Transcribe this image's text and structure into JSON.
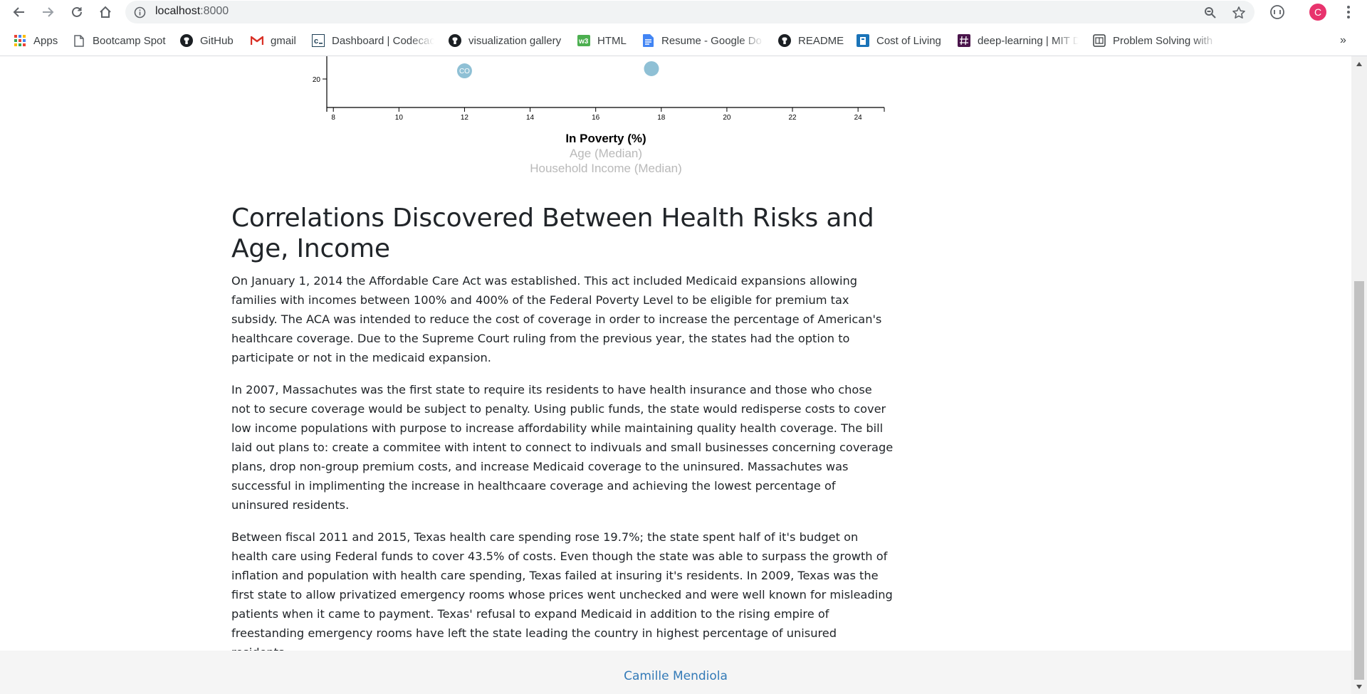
{
  "browser": {
    "url_host": "localhost",
    "url_port": ":8000",
    "profile_initial": "C",
    "accent_profile": "#e8336d"
  },
  "bookmarks": [
    {
      "label": "Apps",
      "icon": "apps-grid-icon"
    },
    {
      "label": "Bootcamp Spot",
      "icon": "page-icon"
    },
    {
      "label": "GitHub",
      "icon": "github-icon"
    },
    {
      "label": "gmail",
      "icon": "gmail-icon"
    },
    {
      "label": "Dashboard | Codecac",
      "icon": "codecademy-icon"
    },
    {
      "label": "visualization gallery",
      "icon": "github-icon"
    },
    {
      "label": "HTML",
      "icon": "w3schools-icon"
    },
    {
      "label": "Resume - Google Do",
      "icon": "google-docs-icon"
    },
    {
      "label": "README",
      "icon": "github-icon"
    },
    {
      "label": "Cost of Living",
      "icon": "cost-of-living-icon"
    },
    {
      "label": "deep-learning | MIT D",
      "icon": "slack-icon"
    },
    {
      "label": "Problem Solving with",
      "icon": "book-icon"
    }
  ],
  "chart_data": {
    "type": "scatter",
    "x_ticks": [
      "8",
      "10",
      "12",
      "14",
      "16",
      "18",
      "20",
      "22",
      "24"
    ],
    "y_ticks": [
      "20"
    ],
    "xlim": [
      7.8,
      24.8
    ],
    "points": [
      {
        "label": "CO",
        "x": 12.0,
        "y": 21.1
      },
      {
        "label": "",
        "x": 17.7,
        "y": 21.4
      }
    ],
    "x_axis_labels": [
      {
        "text": "In Poverty (%)",
        "active": true
      },
      {
        "text": "Age (Median)",
        "active": false
      },
      {
        "text": "Household Income (Median)",
        "active": false
      }
    ],
    "marker_color": "#89bdd3"
  },
  "article": {
    "title": "Correlations Discovered Between Health Risks and Age, Income",
    "paragraphs": [
      "On January 1, 2014 the Affordable Care Act was established. This act included Medicaid expansions allowing families with incomes between 100% and 400% of the Federal Poverty Level to be eligible for premium tax subsidy. The ACA was intended to reduce the cost of coverage in order to increase the percentage of American's healthcare coverage. Due to the Supreme Court ruling from the previous year, the states had the option to participate or not in the medicaid expansion.",
      "In 2007, Massachutes was the first state to require its residents to have health insurance and those who chose not to secure coverage would be subject to penalty. Using public funds, the state would redisperse costs to cover low income populations with purpose to increase affordability while maintaining quality health coverage. The bill laid out plans to: create a commitee with intent to connect to indivuals and small businesses concerning coverage plans, drop non-group premium costs, and increase Medicaid coverage to the uninsured. Massachutes was successful in implimenting the increase in healthcaare coverage and achieving the lowest percentage of uninsured residents.",
      "Between fiscal 2011 and 2015, Texas health care spending rose 19.7%; the state spent half of it's budget on health care using Federal funds to cover 43.5% of costs. Even though the state was able to surpass the growth of inflation and population with health care spending, Texas failed at insuring it's residents. In 2009, Texas was the first state to allow privatized emergency rooms whose prices went unchecked and were well known for misleading patients when it came to payment. Texas' refusal to expand Medicaid in addition to the rising empire of freestanding emergency rooms have left the state leading the country in highest percentage of unisured residents."
    ]
  },
  "footer": {
    "author": "Camille Mendiola",
    "link_color": "#337ab7"
  }
}
